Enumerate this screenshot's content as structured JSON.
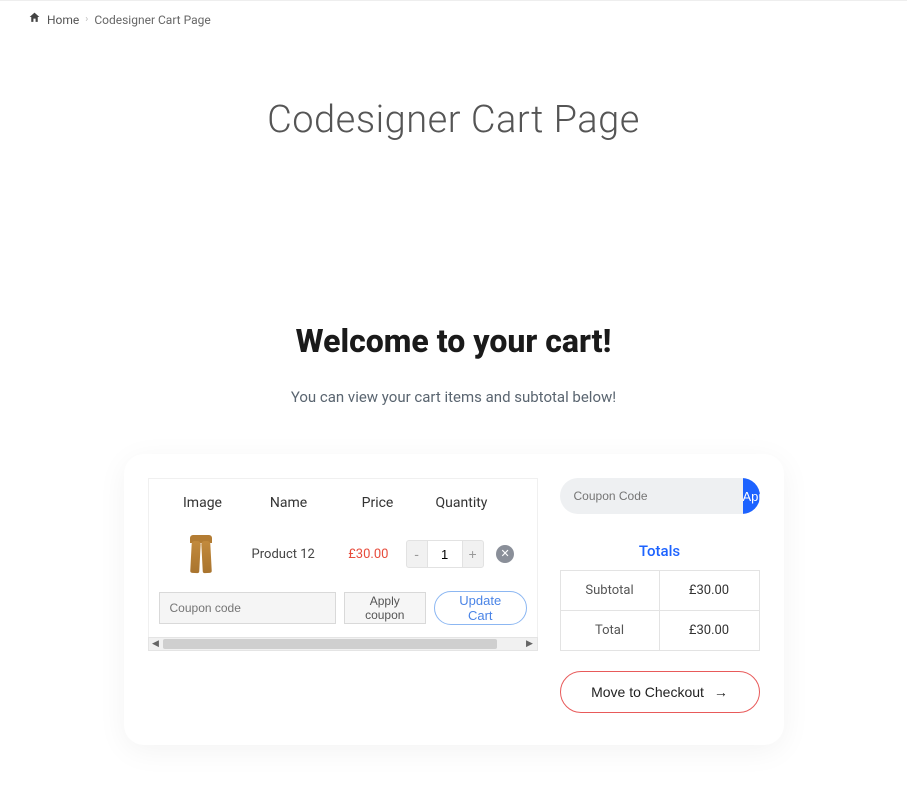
{
  "breadcrumb": {
    "home": "Home",
    "current": "Codesigner Cart Page"
  },
  "page_title": "Codesigner Cart Page",
  "hero": {
    "heading": "Welcome to your cart!",
    "sub": "You can view your cart items and subtotal below!"
  },
  "cart": {
    "headers": {
      "image": "Image",
      "name": "Name",
      "price": "Price",
      "qty": "Quantity"
    },
    "item": {
      "name": "Product 12",
      "price": "£30.00",
      "qty": "1"
    },
    "coupon_placeholder": "Coupon code",
    "apply_coupon": "Apply coupon",
    "update_cart": "Update Cart"
  },
  "side_coupon": {
    "placeholder": "Coupon Code",
    "apply": "Apply"
  },
  "totals": {
    "title": "Totals",
    "subtotal_label": "Subtotal",
    "subtotal_value": "£30.00",
    "total_label": "Total",
    "total_value": "£30.00"
  },
  "checkout_label": "Move to Checkout"
}
